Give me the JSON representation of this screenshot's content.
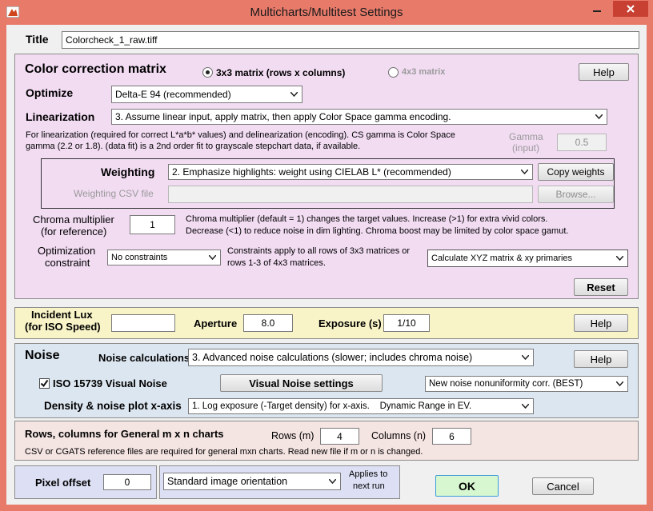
{
  "window": {
    "title": "Multicharts/Multitest Settings"
  },
  "title_field": {
    "label": "Title",
    "value": "Colorcheck_1_raw.tiff"
  },
  "ccm": {
    "heading": "Color correction matrix",
    "radio_3x3": "3x3 matrix  (rows x columns)",
    "radio_4x4": "4x3 matrix",
    "help": "Help",
    "optimize_label": "Optimize",
    "optimize_value": "Delta-E 94  (recommended)",
    "linearization_label": "Linearization",
    "linearization_value": "3.  Assume linear input, apply matrix, then apply Color Space gamma encoding.",
    "note_line1": "For linearization (required for correct L*a*b* values) and delinearization (encoding). CS gamma is Color Space",
    "note_line2": "gamma (2.2 or 1.8). (data fit) is a 2nd order fit to grayscale stepchart data, if available.",
    "gamma_label1": "Gamma",
    "gamma_label2": "(input)",
    "gamma_value": "0.5",
    "weighting_label": "Weighting",
    "weighting_value": "2.  Emphasize highlights: weight using CIELAB L*  (recommended)",
    "copy_weights": "Copy weights",
    "weighting_csv_label": "Weighting CSV file",
    "browse": "Browse...",
    "chroma_label1": "Chroma multiplier",
    "chroma_label2": "(for reference)",
    "chroma_value": "1",
    "chroma_note1": "Chroma multiplier (default = 1) changes the target values. Increase (>1) for extra vivid colors.",
    "chroma_note2": "Decrease (<1) to reduce noise in dim lighting. Chroma boost may be limited by color space gamut.",
    "opt_constraint_label1": "Optimization",
    "opt_constraint_label2": "constraint",
    "opt_constraint_value": "No constraints",
    "constraint_note1": "Constraints apply to all rows of 3x3 matrices or",
    "constraint_note2": "rows 1-3 of 4x3 matrices.",
    "xyz_value": "Calculate XYZ matrix & xy primaries",
    "reset": "Reset"
  },
  "lux": {
    "label1": "Incident Lux",
    "label2": "(for ISO Speed)",
    "value": "",
    "aperture_label": "Aperture",
    "aperture_value": "8.0",
    "exposure_label": "Exposure (s)",
    "exposure_value": "1/10",
    "help": "Help"
  },
  "noise": {
    "heading": "Noise",
    "calc_label": "Noise calculations",
    "calc_value": "3. Advanced noise calculations (slower; includes chroma noise)",
    "help": "Help",
    "iso_label": "ISO 15739 Visual Noise",
    "iso_checked": true,
    "visual_settings": "Visual Noise settings",
    "nonuniformity_value": "New noise nonuniformity corr. (BEST)",
    "density_label": "Density & noise plot x-axis",
    "density_value": "1. Log exposure (-Target density) for x-axis.    Dynamic Range in EV."
  },
  "mxn": {
    "heading": "Rows, columns for General m x n charts",
    "rows_label": "Rows (m)",
    "rows_value": "4",
    "cols_label": "Columns (n)",
    "cols_value": "6",
    "note": "CSV or CGATS reference files are required for general mxn charts.  Read new file if m or n is changed."
  },
  "bottom": {
    "pixel_offset_label": "Pixel offset",
    "pixel_offset_value": "0",
    "orientation_value": "Standard image orientation",
    "applies1": "Applies to",
    "applies2": "next run",
    "ok": "OK",
    "cancel": "Cancel"
  },
  "colors": {
    "titlebar": "#e87a6a",
    "ccm_panel": "#f2dcf2",
    "lux_panel": "#f8f4c8",
    "noise_panel": "#dce6f0",
    "mxn_panel": "#f4e4e2",
    "bottom_panel": "#dde0f4",
    "close_button": "#c74032"
  }
}
